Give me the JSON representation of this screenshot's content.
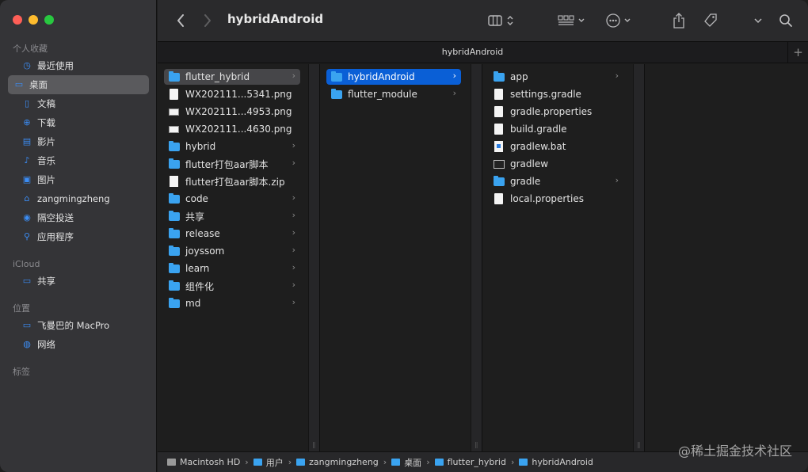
{
  "window": {
    "title": "hybridAndroid",
    "tab_title": "hybridAndroid"
  },
  "toolbar": {
    "back_icon": "chevron-left-icon",
    "forward_icon": "chevron-right-icon",
    "view_icon": "column-view-icon",
    "group_icon": "group-icon",
    "action_icon": "ellipsis-circle-icon",
    "share_icon": "share-icon",
    "tag_icon": "tag-icon",
    "more_icon": "chevron-down-icon",
    "search_icon": "search-icon"
  },
  "sidebar": {
    "favorites_heading": "个人收藏",
    "favorites": [
      {
        "label": "最近使用",
        "icon": "clock-icon"
      },
      {
        "label": "桌面",
        "icon": "desktop-icon",
        "selected": true
      },
      {
        "label": "文稿",
        "icon": "document-icon"
      },
      {
        "label": "下载",
        "icon": "download-icon"
      },
      {
        "label": "影片",
        "icon": "film-icon"
      },
      {
        "label": "音乐",
        "icon": "music-icon"
      },
      {
        "label": "图片",
        "icon": "photo-icon"
      },
      {
        "label": "zangmingzheng",
        "icon": "home-icon"
      },
      {
        "label": "隔空投送",
        "icon": "airdrop-icon"
      },
      {
        "label": "应用程序",
        "icon": "applications-icon"
      }
    ],
    "icloud_heading": "iCloud",
    "icloud": [
      {
        "label": "共享",
        "icon": "shared-folder-icon"
      }
    ],
    "locations_heading": "位置",
    "locations": [
      {
        "label": "飞曼巴的 MacPro",
        "icon": "laptop-icon"
      },
      {
        "label": "网络",
        "icon": "network-icon"
      }
    ],
    "tags_heading": "标签"
  },
  "columns": [
    {
      "items": [
        {
          "name": "flutter_hybrid",
          "kind": "folder",
          "chevron": true,
          "state": "inactive"
        },
        {
          "name": "WX202111...5341.png",
          "kind": "doc"
        },
        {
          "name": "WX202111...4953.png",
          "kind": "img"
        },
        {
          "name": "WX202111...4630.png",
          "kind": "img"
        },
        {
          "name": "hybrid",
          "kind": "folder",
          "chevron": true
        },
        {
          "name": "flutter打包aar脚本",
          "kind": "folder",
          "chevron": true
        },
        {
          "name": "flutter打包aar脚本.zip",
          "kind": "zip"
        },
        {
          "name": "code",
          "kind": "folder",
          "chevron": true
        },
        {
          "name": "共享",
          "kind": "folder",
          "chevron": true
        },
        {
          "name": "release",
          "kind": "folder",
          "chevron": true
        },
        {
          "name": "joyssom",
          "kind": "folder",
          "chevron": true
        },
        {
          "name": "learn",
          "kind": "folder",
          "chevron": true
        },
        {
          "name": "组件化",
          "kind": "folder",
          "chevron": true
        },
        {
          "name": "md",
          "kind": "folder",
          "chevron": true
        }
      ]
    },
    {
      "items": [
        {
          "name": "hybridAndroid",
          "kind": "folder",
          "chevron": true,
          "state": "active"
        },
        {
          "name": "flutter_module",
          "kind": "folder",
          "chevron": true
        }
      ]
    },
    {
      "items": [
        {
          "name": "app",
          "kind": "folder",
          "chevron": true
        },
        {
          "name": "settings.gradle",
          "kind": "doc"
        },
        {
          "name": "gradle.properties",
          "kind": "doc"
        },
        {
          "name": "build.gradle",
          "kind": "doc"
        },
        {
          "name": "gradlew.bat",
          "kind": "bat"
        },
        {
          "name": "gradlew",
          "kind": "exec"
        },
        {
          "name": "gradle",
          "kind": "folder",
          "chevron": true
        },
        {
          "name": "local.properties",
          "kind": "doc"
        }
      ]
    }
  ],
  "pathbar": [
    {
      "label": "Macintosh HD",
      "kind": "hd"
    },
    {
      "label": "用户",
      "kind": "folder"
    },
    {
      "label": "zangmingzheng",
      "kind": "folder"
    },
    {
      "label": "桌面",
      "kind": "folder"
    },
    {
      "label": "flutter_hybrid",
      "kind": "folder"
    },
    {
      "label": "hybridAndroid",
      "kind": "folder"
    }
  ],
  "watermark": "@稀土掘金技术社区",
  "colors": {
    "accent": "#0a5fd6",
    "folder": "#3aa3f0",
    "sidebar_icon": "#3b8df5"
  }
}
